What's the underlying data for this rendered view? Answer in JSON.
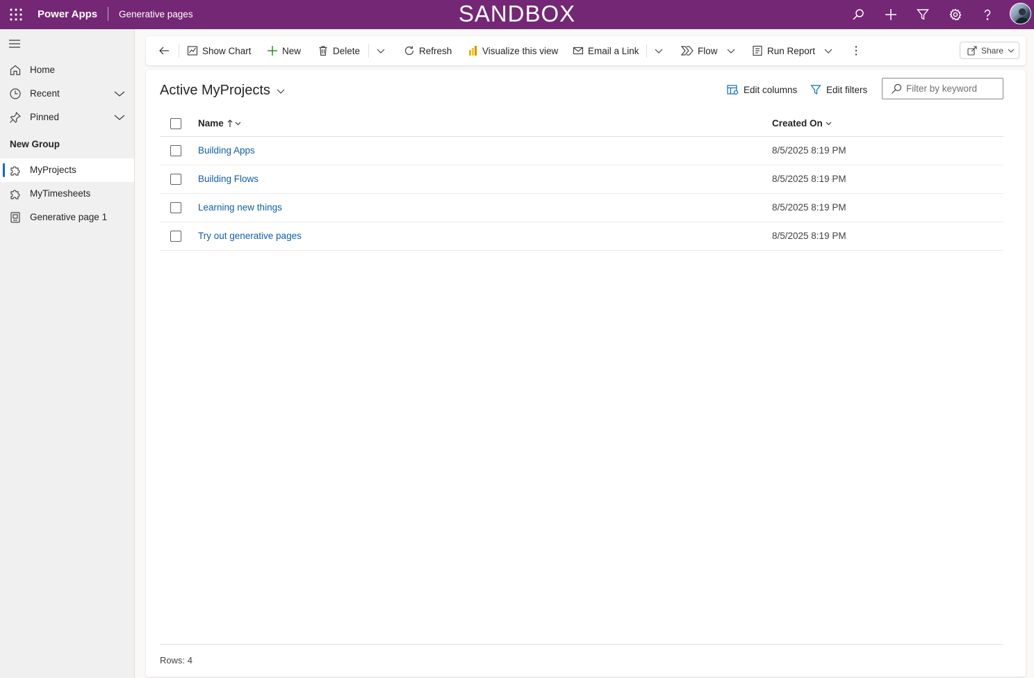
{
  "topbar": {
    "app_name": "Power Apps",
    "page_name": "Generative pages",
    "environment_banner": "SANDBOX",
    "icons": [
      "waffle-icon",
      "search-icon",
      "plus-icon",
      "filter-icon",
      "gear-icon",
      "help-icon",
      "user-avatar"
    ],
    "background_color": "#742774"
  },
  "sidebar": {
    "items": [
      {
        "label": "Home",
        "icon": "home-icon"
      },
      {
        "label": "Recent",
        "icon": "clock-icon",
        "expandable": true
      },
      {
        "label": "Pinned",
        "icon": "pin-icon",
        "expandable": true
      }
    ],
    "group_label": "New Group",
    "group_items": [
      {
        "label": "MyProjects",
        "icon": "puzzle-icon",
        "active": true
      },
      {
        "label": "MyTimesheets",
        "icon": "puzzle-icon"
      },
      {
        "label": "Generative page 1",
        "icon": "page-icon"
      }
    ]
  },
  "commandbar": {
    "show_chart": "Show Chart",
    "new": "New",
    "delete": "Delete",
    "refresh": "Refresh",
    "visualize": "Visualize this view",
    "email_link": "Email a Link",
    "flow": "Flow",
    "run_report": "Run Report",
    "share": "Share"
  },
  "view": {
    "title": "Active MyProjects",
    "edit_columns": "Edit columns",
    "edit_filters": "Edit filters",
    "filter_placeholder": "Filter by keyword",
    "columns": {
      "name": "Name",
      "created_on": "Created On"
    },
    "rows": [
      {
        "name": "Building Apps",
        "created_on": "8/5/2025 8:19 PM"
      },
      {
        "name": "Building Flows",
        "created_on": "8/5/2025 8:19 PM"
      },
      {
        "name": "Learning new things",
        "created_on": "8/5/2025 8:19 PM"
      },
      {
        "name": "Try out generative pages",
        "created_on": "8/5/2025 8:19 PM"
      }
    ],
    "rows_count": "Rows: 4"
  },
  "colors": {
    "accent": "#742774",
    "link": "#115ea3",
    "active_indicator": "#0f6cbd"
  }
}
